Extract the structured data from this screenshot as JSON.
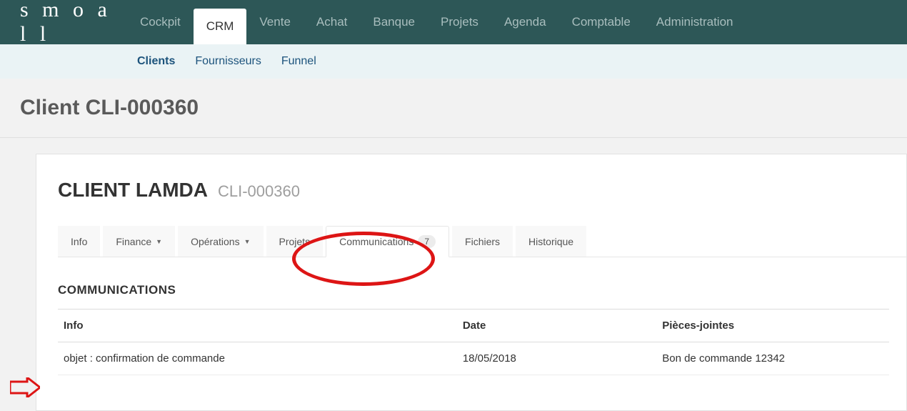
{
  "brand": "s m o a l l",
  "topnav": [
    {
      "label": "Cockpit"
    },
    {
      "label": "CRM",
      "active": true
    },
    {
      "label": "Vente"
    },
    {
      "label": "Achat"
    },
    {
      "label": "Banque"
    },
    {
      "label": "Projets"
    },
    {
      "label": "Agenda"
    },
    {
      "label": "Comptable"
    },
    {
      "label": "Administration"
    }
  ],
  "subnav": [
    {
      "label": "Clients",
      "active": true
    },
    {
      "label": "Fournisseurs"
    },
    {
      "label": "Funnel"
    }
  ],
  "page_title": "Client CLI-000360",
  "client": {
    "name": "CLIENT LAMDA",
    "code": "CLI-000360"
  },
  "tabs": {
    "info": "Info",
    "finance": "Finance",
    "operations": "Opérations",
    "projets": "Projets",
    "communications_label": "Communications",
    "communications_count": "7",
    "fichiers": "Fichiers",
    "historique": "Historique"
  },
  "section_heading": "COMMUNICATIONS",
  "table": {
    "headers": {
      "info": "Info",
      "date": "Date",
      "pj": "Pièces-jointes"
    },
    "rows": [
      {
        "info": "objet : confirmation de commande",
        "date": "18/05/2018",
        "pj": "Bon de commande 12342"
      }
    ]
  }
}
